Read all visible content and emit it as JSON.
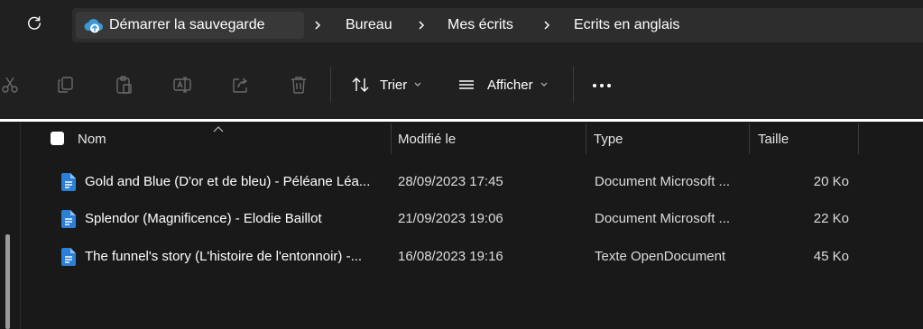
{
  "breadcrumb": {
    "items": [
      "Démarrer la sauvegarde",
      "Bureau",
      "Mes écrits",
      "Ecrits en anglais"
    ],
    "separator": ">"
  },
  "toolbar": {
    "sort_label": "Trier",
    "view_label": "Afficher"
  },
  "columns": {
    "name": "Nom",
    "modified": "Modifié le",
    "type": "Type",
    "size": "Taille"
  },
  "files": [
    {
      "name": "Gold and Blue (D'or et de bleu) - Péléane Léa...",
      "modified": "28/09/2023 17:45",
      "type": "Document Microsoft ...",
      "size": "20 Ko",
      "icon": "word-document-icon"
    },
    {
      "name": "Splendor (Magnificence) - Elodie Baillot",
      "modified": "21/09/2023 19:06",
      "type": "Document Microsoft ...",
      "size": "22 Ko",
      "icon": "word-document-icon"
    },
    {
      "name": "The funnel's story (L'histoire de l'entonnoir) -...",
      "modified": "16/08/2023 19:16",
      "type": "Texte OpenDocument",
      "size": "45 Ko",
      "icon": "odt-document-icon"
    }
  ],
  "colors": {
    "background": "#191919",
    "bar": "#202020",
    "doc_icon": "#2b7fd8",
    "cloud_icon": "#3a9ad9"
  }
}
